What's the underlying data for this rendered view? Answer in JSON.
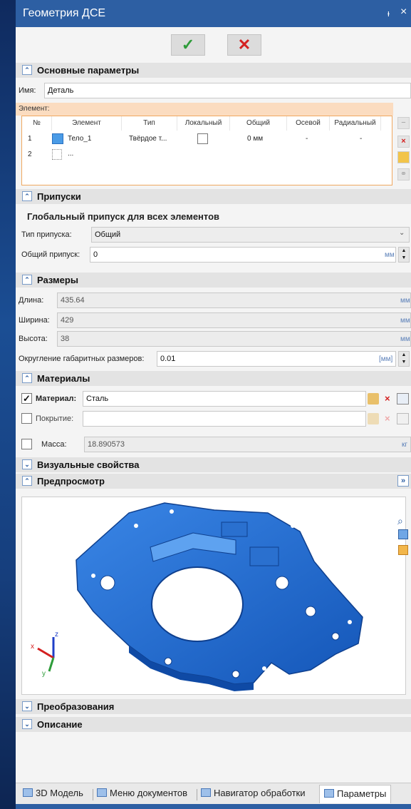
{
  "window": {
    "title": "Геометрия ДСЕ",
    "pin_glyph": "ᵼ",
    "close_glyph": "×"
  },
  "actions": {
    "ok_glyph": "✓",
    "cancel_glyph": "✕"
  },
  "main_params": {
    "header": "Основные параметры",
    "name_label": "Имя:",
    "name_value": "Деталь",
    "element_label": "Элемент:",
    "columns": [
      "№",
      "Элемент",
      "Тип",
      "Локальный",
      "Общий",
      "Осевой",
      "Радиальный"
    ],
    "rows": [
      {
        "num": "1",
        "element": "Тело_1",
        "type": "Твёрдое т...",
        "common": "0 мм",
        "axial": "-",
        "radial": "-"
      },
      {
        "num": "2",
        "element": "..."
      }
    ]
  },
  "allowances": {
    "header": "Припуски",
    "subheader": "Глобальный припуск для всех элементов",
    "type_label": "Тип припуска:",
    "type_value": "Общий",
    "total_label": "Общий припуск:",
    "total_value": "0",
    "total_unit": "мм"
  },
  "dimensions": {
    "header": "Размеры",
    "length_label": "Длина:",
    "length_value": "435.64",
    "width_label": "Ширина:",
    "width_value": "429",
    "height_label": "Высота:",
    "height_value": "38",
    "unit": "мм",
    "round_label": "Округление габаритных размеров:",
    "round_value": "0.01",
    "round_unit": "[мм]"
  },
  "materials": {
    "header": "Материалы",
    "material_label": "Материал:",
    "material_value": "Сталь",
    "coating_label": "Покрытие:",
    "mass_label": "Масса:",
    "mass_value": "18.890573",
    "mass_unit": "кг"
  },
  "visual": {
    "header": "Визуальные свойства"
  },
  "preview": {
    "header": "Предпросмотр",
    "expand_glyph": "»",
    "axis_x": "x",
    "axis_y": "y",
    "axis_z": "z"
  },
  "transforms": {
    "header": "Преобразования"
  },
  "description": {
    "header": "Описание"
  },
  "tabs": [
    {
      "label": "3D Модель"
    },
    {
      "label": "Меню документов"
    },
    {
      "label": "Навигатор обработки"
    },
    {
      "label": "Параметры"
    }
  ],
  "colors": {
    "accent": "#2d5fa3",
    "part": "#1f6fd4",
    "element_band": "#fbdcc0"
  }
}
